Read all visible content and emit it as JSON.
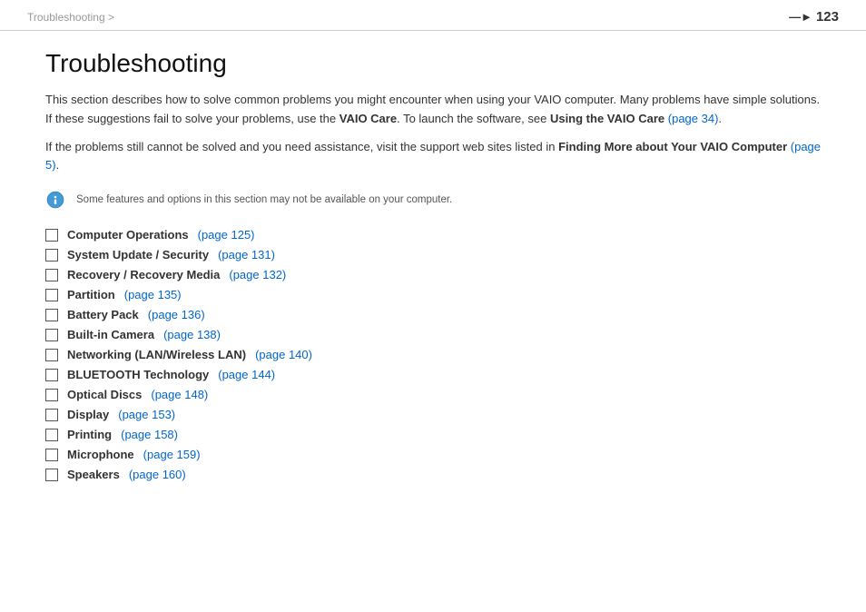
{
  "breadcrumb": {
    "text": "Troubleshooting >"
  },
  "page_number": "123",
  "title": "Troubleshooting",
  "intro": {
    "para1": "This section describes how to solve common problems you might encounter when using your VAIO computer. Many problems have simple solutions. If these suggestions fail to solve your problems, use the ",
    "para1_bold1": "VAIO Care",
    "para1_mid": ". To launch the software, see ",
    "para1_bold2": "Using the VAIO Care",
    "para1_link": "(page 34)",
    "para1_end": ".",
    "para2_start": "If the problems still cannot be solved and you need assistance, visit the support web sites listed in ",
    "para2_bold": "Finding More about Your VAIO Computer",
    "para2_link": "(page 5)",
    "para2_end": "."
  },
  "note": {
    "text": "Some features and options in this section may not be available on your computer."
  },
  "topics": [
    {
      "label": "Computer Operations",
      "link": "(page 125)"
    },
    {
      "label": "System Update / Security",
      "link": "(page 131)"
    },
    {
      "label": "Recovery / Recovery Media",
      "link": "(page 132)"
    },
    {
      "label": "Partition",
      "link": "(page 135)"
    },
    {
      "label": "Battery Pack",
      "link": "(page 136)"
    },
    {
      "label": "Built-in Camera",
      "link": "(page 138)"
    },
    {
      "label": "Networking (LAN/Wireless LAN)",
      "link": "(page 140)"
    },
    {
      "label": "BLUETOOTH Technology",
      "link": "(page 144)"
    },
    {
      "label": "Optical Discs",
      "link": "(page 148)"
    },
    {
      "label": "Display",
      "link": "(page 153)"
    },
    {
      "label": "Printing",
      "link": "(page 158)"
    },
    {
      "label": "Microphone",
      "link": "(page 159)"
    },
    {
      "label": "Speakers",
      "link": "(page 160)"
    }
  ],
  "colors": {
    "link": "#0066cc",
    "border": "#cccccc"
  }
}
